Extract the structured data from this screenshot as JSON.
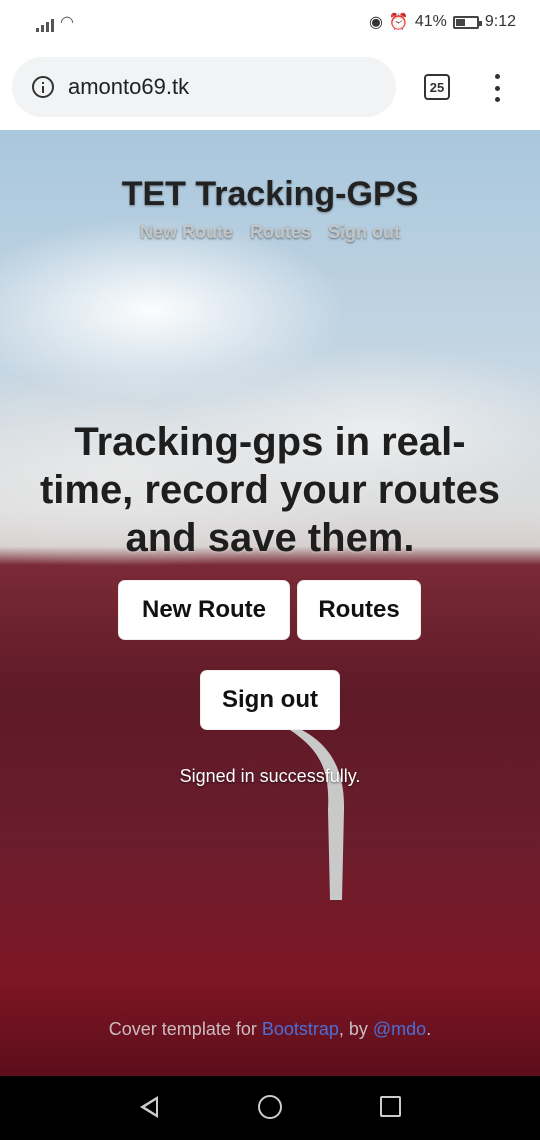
{
  "status_bar": {
    "battery": "41%",
    "time": "9:12",
    "battery_level": 0.41
  },
  "browser": {
    "url": "amonto69.tk",
    "tab_count": "25"
  },
  "header": {
    "title": "TET Tracking-GPS",
    "nav": [
      "New Route",
      "Routes",
      "Sign out"
    ]
  },
  "main": {
    "headline": "Tracking-gps in real-time, record your routes and save them.",
    "buttons": {
      "new_route": "New Route",
      "routes": "Routes",
      "sign_out": "Sign out"
    },
    "status_message": "Signed in successfully."
  },
  "footer": {
    "prefix": "Cover template for ",
    "link1": "Bootstrap",
    "middle": ", by ",
    "link2": "@mdo",
    "suffix": "."
  },
  "colors": {
    "link": "#4a6fd8",
    "button_bg": "#ffffff"
  }
}
